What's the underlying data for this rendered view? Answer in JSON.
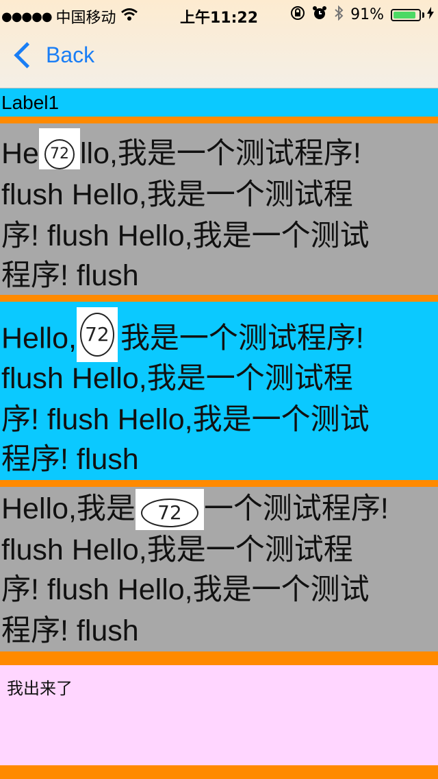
{
  "status_bar": {
    "signal_dots": "●●●●●",
    "carrier": "中国移动",
    "time": "上午11:22",
    "battery_percent": "91%",
    "battery_level": 0.91
  },
  "nav": {
    "back_label": "Back"
  },
  "label1": "Label1",
  "block1": {
    "line1_a": "He",
    "line1_b": "llo,我是一个测试程序!",
    "line2": "flush  Hello,我是一个测试程",
    "line3": "序! flush Hello,我是一个测试",
    "line4": "程序! flush",
    "emoji_text": "72"
  },
  "block2": {
    "line1_a": "Hello,",
    "line1_b": "我是一个测试程序!",
    "line2": "flush  Hello,我是一个测试程",
    "line3": "序! flush Hello,我是一个测试",
    "line4": "程序! flush",
    "emoji_text": "72"
  },
  "block3": {
    "line1_a": "Hello,我是",
    "line1_b": "一个测试程序!",
    "line2": "flush  Hello,我是一个测试程",
    "line3": "序! flush Hello,我是一个测试",
    "line4": "程序! flush",
    "emoji_text": "72"
  },
  "pink_text": "我出来了",
  "colors": {
    "accent_blue": "#1a7ef5",
    "cyan": "#0bc9ff",
    "gray": "#a8a8a8",
    "orange": "#ff8a00",
    "pink": "#ffd6ff"
  }
}
